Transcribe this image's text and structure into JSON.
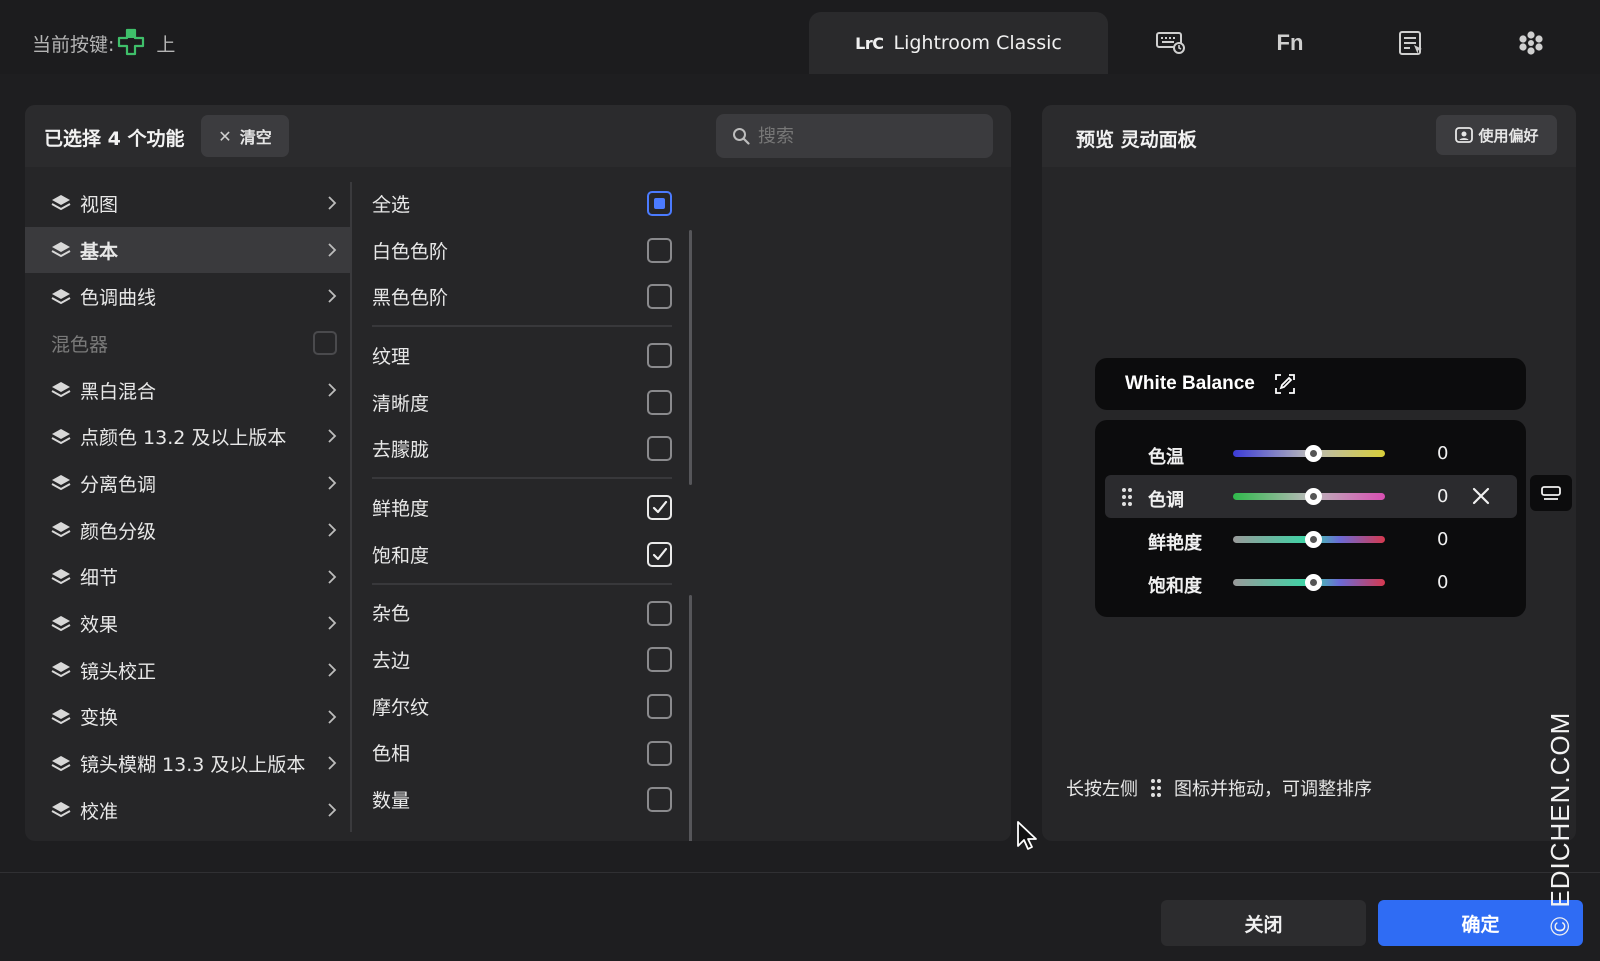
{
  "topbar": {
    "current_key_label": "当前按键:",
    "current_key_value": "上",
    "active_tab_badge": "LrC",
    "active_tab_label": "Lightroom Classic",
    "fn_label": "Fn",
    "icons": [
      "keyboard-icon",
      "fn-icon",
      "list-cursor-icon",
      "flower-icon"
    ]
  },
  "left": {
    "selected_count": "已选择 4 个功能",
    "clear_label": "清空",
    "search_placeholder": "搜索",
    "categories": [
      {
        "label": "视图",
        "active": false
      },
      {
        "label": "基本",
        "active": true
      },
      {
        "label": "色调曲线",
        "active": false
      },
      {
        "label": "混色器",
        "disabled": true
      },
      {
        "label": "黑白混合",
        "active": false
      },
      {
        "label": "点颜色 13.2 及以上版本",
        "active": false
      },
      {
        "label": "分离色调",
        "active": false
      },
      {
        "label": "颜色分级",
        "active": false
      },
      {
        "label": "细节",
        "active": false
      },
      {
        "label": "效果",
        "active": false
      },
      {
        "label": "镜头校正",
        "active": false
      },
      {
        "label": "变换",
        "active": false
      },
      {
        "label": "镜头模糊 13.3 及以上版本",
        "active": false
      },
      {
        "label": "校准",
        "active": false
      }
    ],
    "options": [
      {
        "label": "全选",
        "state": "partial"
      },
      {
        "label": "白色色阶",
        "state": "unchecked"
      },
      {
        "label": "黑色色阶",
        "state": "unchecked"
      },
      {
        "label": "纹理",
        "state": "unchecked"
      },
      {
        "label": "清晰度",
        "state": "unchecked"
      },
      {
        "label": "去朦胧",
        "state": "unchecked"
      },
      {
        "label": "鲜艳度",
        "state": "checked"
      },
      {
        "label": "饱和度",
        "state": "checked"
      },
      {
        "label": "杂色",
        "state": "unchecked"
      },
      {
        "label": "去边",
        "state": "unchecked"
      },
      {
        "label": "摩尔纹",
        "state": "unchecked"
      },
      {
        "label": "色相",
        "state": "unchecked"
      },
      {
        "label": "数量",
        "state": "unchecked"
      }
    ]
  },
  "preview": {
    "title": "预览 灵动面板",
    "pref_label": "使用偏好",
    "panel_title": "White Balance",
    "sliders": [
      {
        "label": "色温",
        "value": "0",
        "gradient": [
          "#3b3bd6",
          "#b9b9b9",
          "#d8cf3a"
        ]
      },
      {
        "label": "色调",
        "value": "0",
        "gradient": [
          "#2fb94b",
          "#b9b9b9",
          "#d94fb3"
        ],
        "hover": true
      },
      {
        "label": "鲜艳度",
        "value": "0",
        "gradient": [
          "#9a9a9a",
          "#3bd6a6",
          "#d6394f"
        ]
      },
      {
        "label": "饱和度",
        "value": "0",
        "gradient": [
          "#9a9a9a",
          "#3bd6a6",
          "#d6394f"
        ]
      }
    ],
    "hint_before": "长按左侧",
    "hint_after": "图标并拖动，可调整排序"
  },
  "footer": {
    "close_label": "关闭",
    "ok_label": "确定",
    "watermark": "© EDICHEN.COM"
  },
  "colors": {
    "accent": "#2f6cf4",
    "background": "#1e1e20",
    "panel": "#262628"
  }
}
